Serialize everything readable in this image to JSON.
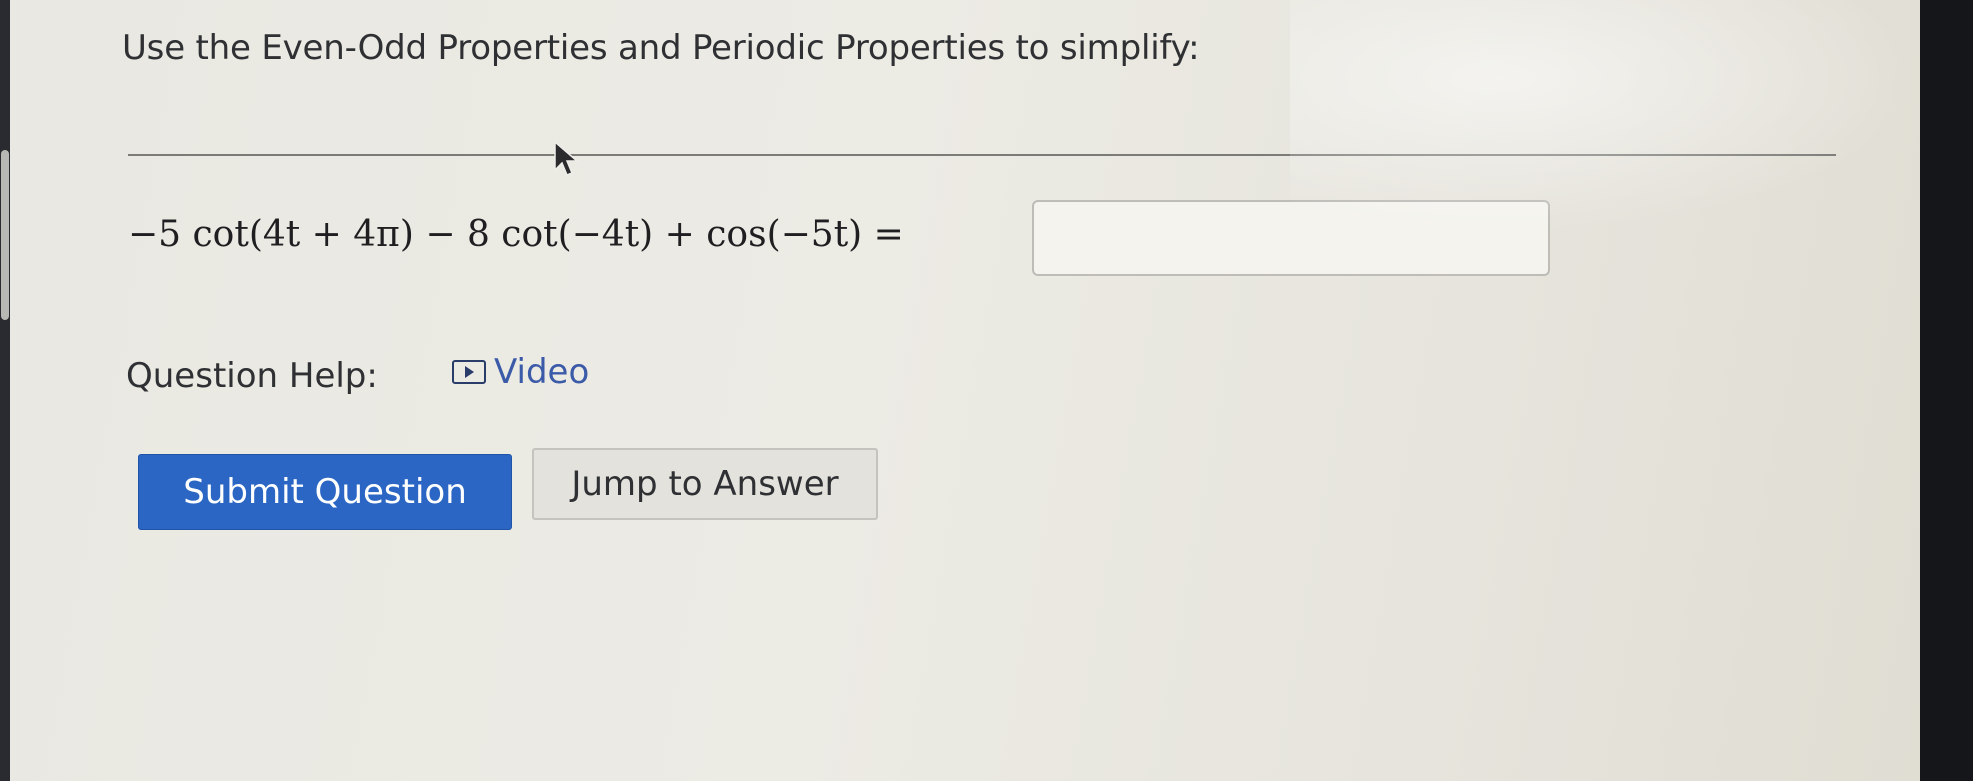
{
  "question": {
    "instructions": "Use the Even-Odd Properties and Periodic Properties to simplify:",
    "equation": "−5 cot(4t + 4π) − 8 cot(−4t) + cos(−5t) ="
  },
  "answer": {
    "value": ""
  },
  "help": {
    "label": "Question Help:",
    "video_label": "Video",
    "video_icon": "play-video-icon"
  },
  "buttons": {
    "submit_label": "Submit Question",
    "jump_label": "Jump to Answer"
  },
  "colors": {
    "submit_bg": "#2b66c4",
    "link": "#3b5aa8"
  }
}
